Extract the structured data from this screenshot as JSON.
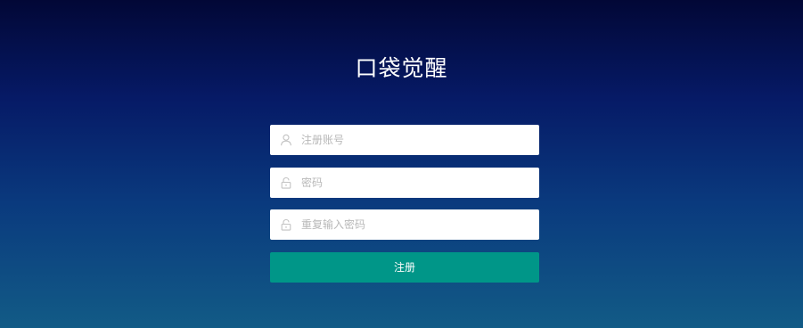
{
  "app": {
    "title": "口袋觉醒"
  },
  "form": {
    "account": {
      "placeholder": "注册账号",
      "value": "",
      "icon": "user-icon"
    },
    "password": {
      "placeholder": "密码",
      "value": "",
      "icon": "lock-icon"
    },
    "confirm_password": {
      "placeholder": "重复输入密码",
      "value": "",
      "icon": "lock-icon"
    },
    "submit_label": "注册"
  },
  "colors": {
    "background_top": "#020736",
    "background_bottom": "#125b86",
    "accent": "#009688",
    "field_background": "#ffffff",
    "placeholder": "#b8b8b8",
    "icon": "#c2c2c2"
  }
}
